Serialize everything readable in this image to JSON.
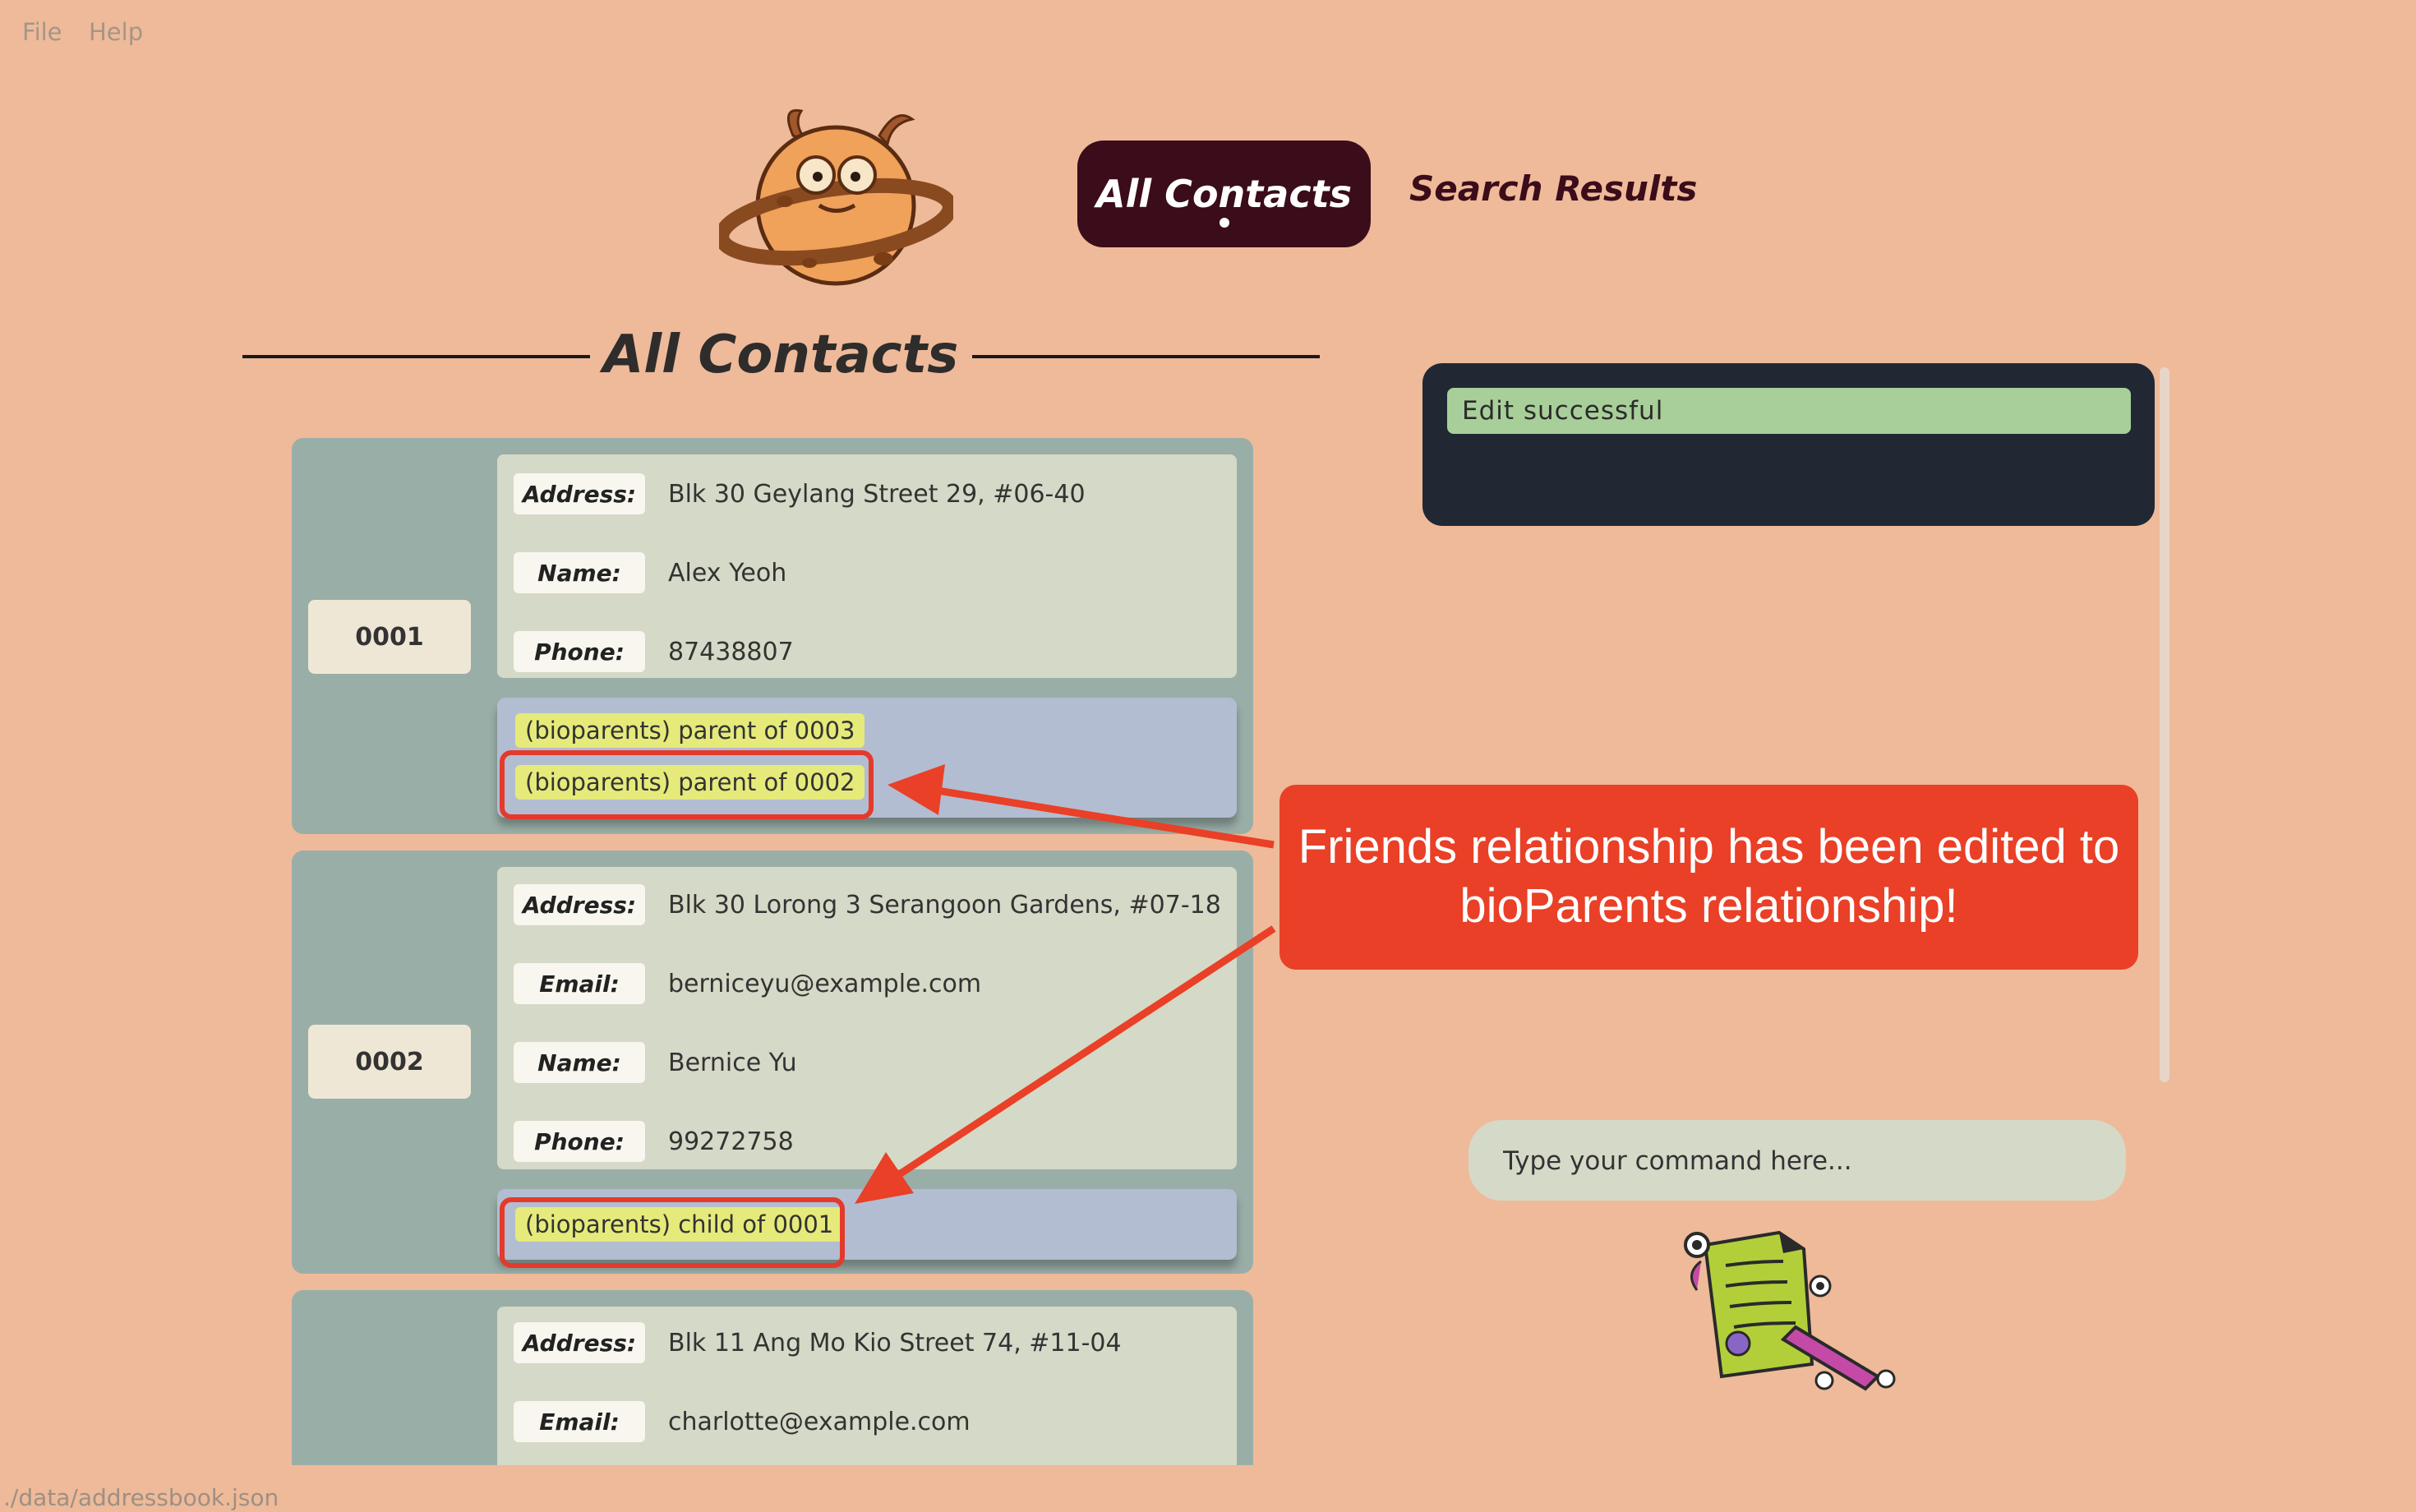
{
  "menu": {
    "file": "File",
    "help": "Help"
  },
  "tabs": {
    "all_contacts": "All Contacts",
    "search_results": "Search Results"
  },
  "section_title": "All Contacts",
  "contacts": [
    {
      "id": "0001",
      "fields": [
        {
          "label": "Address:",
          "value": "Blk 30 Geylang Street 29, #06-40"
        },
        {
          "label": "Name:",
          "value": "Alex Yeoh"
        },
        {
          "label": "Phone:",
          "value": "87438807"
        }
      ],
      "relationships": [
        "(bioparents) parent of 0003",
        "(bioparents) parent of 0002"
      ]
    },
    {
      "id": "0002",
      "fields": [
        {
          "label": "Address:",
          "value": "Blk 30 Lorong 3 Serangoon Gardens, #07-18"
        },
        {
          "label": "Email:",
          "value": "berniceyu@example.com"
        },
        {
          "label": "Name:",
          "value": "Bernice Yu"
        },
        {
          "label": "Phone:",
          "value": "99272758"
        }
      ],
      "relationships": [
        "(bioparents) child of 0001"
      ]
    },
    {
      "id": "",
      "fields": [
        {
          "label": "Address:",
          "value": "Blk 11 Ang Mo Kio Street 74, #11-04"
        },
        {
          "label": "Email:",
          "value": "charlotte@example.com"
        }
      ],
      "relationships": []
    }
  ],
  "result": {
    "message": "Edit successful"
  },
  "command": {
    "placeholder": "Type your command here..."
  },
  "annotation": {
    "text": "Friends relationship has been edited to bioParents relationship!"
  },
  "status_bar": {
    "path": "./data/addressbook.json"
  },
  "colors": {
    "background": "#eeba99",
    "active_tab": "#3b0c19",
    "result_panel": "#212833",
    "success": "#a8cf99",
    "callout": "#e94027",
    "relationship_tag": "#e5ea7a"
  },
  "icons": {
    "logo": "cookie-planet-monster-logo",
    "mascot": "notepad-monster-icon"
  }
}
